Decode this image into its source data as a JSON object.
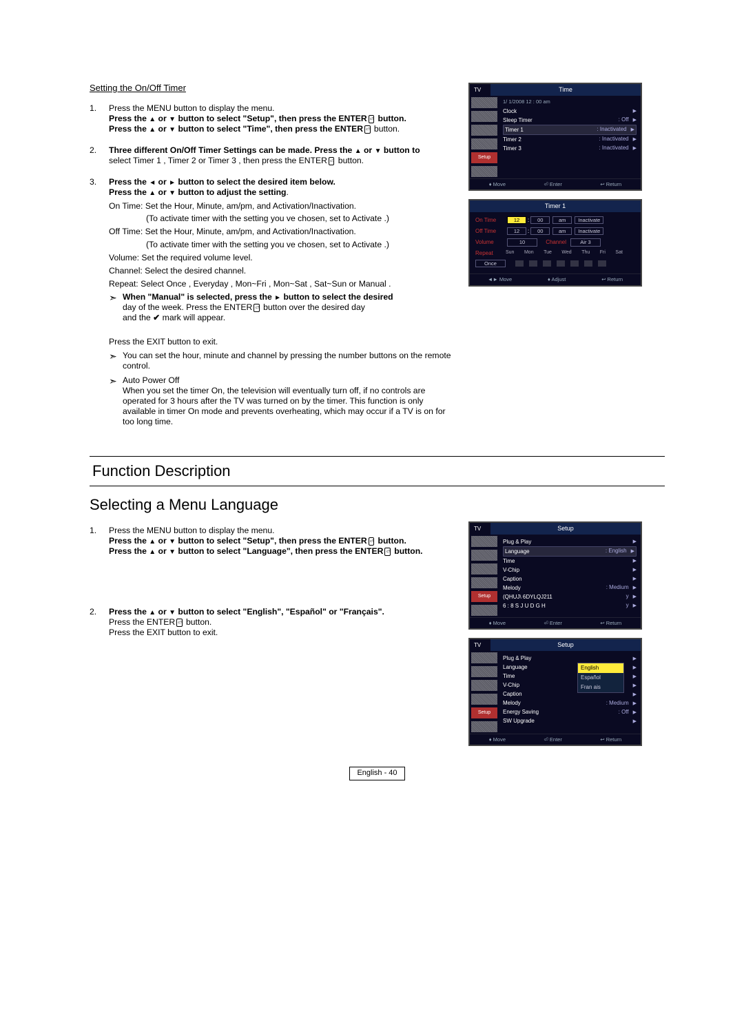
{
  "top": {
    "section_title": "Setting the On/Off Timer",
    "step1_a": "Press the MENU button to display the menu.",
    "step1_b_pre": "Press the ",
    "step1_b_post": " button to select \"Setup\", then press the ENTER",
    "step1_b_end": " button.",
    "step1_c_pre": "Press the ",
    "step1_c_post": " button to select \"Time\", then press the ENTER",
    "step1_c_end": " button.",
    "step2_a": "Three different On/Off Timer Settings can be made. Press the ",
    "step2_b": " button to",
    "step2_line2": "select  Timer 1 ,  Timer 2  or  Timer 3 , then press the  ENTER",
    "step2_end": " button.",
    "step3_a": "Press the ",
    "step3_b": " button to select the desired item below",
    "step3_c_pre": "Press the ",
    "step3_c_post": " button to adjust the setting",
    "detail_on": "On Time:  Set the Hour, Minute, am/pm, and Activation/Inactivation.",
    "detail_on2": "(To activate timer with the setting you ve chosen, set to  Activate .)",
    "detail_off": "Off Time:  Set the Hour, Minute, am/pm, and Activation/Inactivation.",
    "detail_off2": "(To activate timer with the setting you ve chosen, set to  Activate .)",
    "detail_vol": "Volume: Set the required volume level.",
    "detail_ch": "Channel: Select the desired channel.",
    "detail_rep": "Repeat: Select  Once ,  Everyday ,  Mon~Fri ,  Mon~Sat ,  Sat~Sun  or  Manual .",
    "detail_manual1": "When \"Manual\" is selected, press the ",
    "detail_manual2": " button to select the desired",
    "detail_manual3": "day of the week. Press the ENTER",
    "detail_manual4": " button over the desired day",
    "detail_manual5": "and the ",
    "detail_manual6": " mark will appear.",
    "exit": "Press the EXIT button to exit.",
    "number_note": "You can set the hour, minute and channel by pressing the number buttons on the remote control.",
    "auto_title": "Auto  Power Off",
    "auto_body": "When you set the timer On, the television will eventually turn off, if no controls are operated for 3 hours after the TV was turned on by the timer. This function is only available in timer On mode and prevents overheating, which may occur if a TV is on for too long time."
  },
  "bottom": {
    "function_heading": "Function Description",
    "sub_heading": "Selecting a Menu Language",
    "step1_a": "Press the MENU button to display the menu.",
    "step1_b_pre": "Press the ",
    "step1_b_post": " button to select \"Setup\", then press the ENTER",
    "step1_b_end": " button.",
    "step1_c_pre": "Press the ",
    "step1_c_post": " button to select \"Language\", then press the ENTER",
    "step1_c_end": " button.",
    "step2_a": "Press the ",
    "step2_b": " button to select \"English\", \"Español\" or \"Français\".",
    "step2_c": "Press the ENTER",
    "step2_c_end": " button.",
    "exit": "Press the EXIT button to exit."
  },
  "osd_time": {
    "tv": "TV",
    "title": "Time",
    "date": "1/   1/2008  12 : 00 am",
    "rows": [
      {
        "lab": "Clock",
        "val": ""
      },
      {
        "lab": "Sleep Timer",
        "val": ": Off"
      },
      {
        "lab": "Timer 1",
        "val": ": Inactivated",
        "hl": true
      },
      {
        "lab": "Timer 2",
        "val": ": Inactivated"
      },
      {
        "lab": "Timer 3",
        "val": ": Inactivated"
      }
    ],
    "side_sel": "Setup",
    "foot": [
      "♦ Move",
      "⏎ Enter",
      "↩ Return"
    ]
  },
  "osd_timer1": {
    "title": "Timer 1",
    "on": "On Time",
    "off": "Off Time",
    "vol": "Volume",
    "ch": "Channel",
    "rep": "Repeat",
    "once": "Once",
    "h": "12",
    "m": "00",
    "ap": "am",
    "act": "Inactivate",
    "h2": "12",
    "m2": "00",
    "ap2": "am",
    "act2": "Inactivate",
    "volv": "10",
    "chv": "Air  3",
    "days": [
      "Sun",
      "Mon",
      "Tue",
      "Wed",
      "Thu",
      "Fri",
      "Sat"
    ],
    "foot": [
      "◄► Move",
      "♦ Adjust",
      "↩ Return"
    ]
  },
  "osd_setup1": {
    "tv": "TV",
    "title": "Setup",
    "rows": [
      {
        "lab": "Plug & Play",
        "val": ""
      },
      {
        "lab": "Language",
        "val": ": English",
        "hl": true
      },
      {
        "lab": "Time",
        "val": ""
      },
      {
        "lab": "V-Chip",
        "val": ""
      },
      {
        "lab": "Caption",
        "val": ""
      },
      {
        "lab": "Melody",
        "val": ": Medium"
      },
      {
        "lab": "(QHUJ\\ 6DYLQJ211",
        "val": "y"
      },
      {
        "lab": "6 :  8 S J U D G H",
        "val": "y"
      }
    ],
    "side_sel": "Setup",
    "foot": [
      "♦ Move",
      "⏎ Enter",
      "↩ Return"
    ]
  },
  "osd_setup2": {
    "tv": "TV",
    "title": "Setup",
    "rows": [
      {
        "lab": "Plug & Play",
        "val": ""
      },
      {
        "lab": "Language",
        "val": ""
      },
      {
        "lab": "Time",
        "val": ""
      },
      {
        "lab": "V-Chip",
        "val": ""
      },
      {
        "lab": "Caption",
        "val": ""
      },
      {
        "lab": "Melody",
        "val": ": Medium"
      },
      {
        "lab": "Energy Saving",
        "val": ": Off"
      },
      {
        "lab": "SW Upgrade",
        "val": ""
      }
    ],
    "popup": [
      "English",
      "Español",
      "Fran ais"
    ],
    "side_sel": "Setup",
    "foot": [
      "♦ Move",
      "⏎ Enter",
      "↩ Return"
    ]
  },
  "pagenum": "English - 40"
}
